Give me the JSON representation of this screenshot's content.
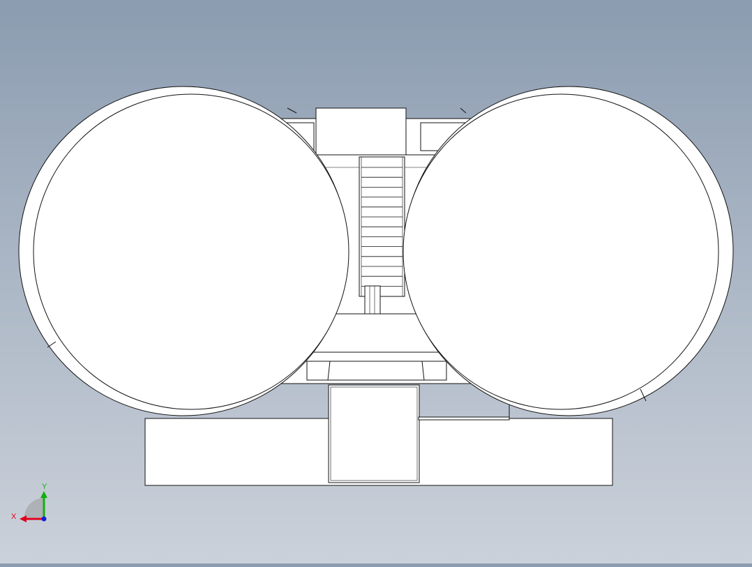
{
  "viewport": {
    "background_top": "#8b9cb0",
    "background_bottom": "#cbd1da",
    "edge_color": "#111111",
    "face_color": "#ffffff"
  },
  "triad": {
    "x_label": "X",
    "y_label": "Y",
    "x_color": "#e0001b",
    "y_color": "#10b010",
    "z_color": "#1020d0"
  }
}
